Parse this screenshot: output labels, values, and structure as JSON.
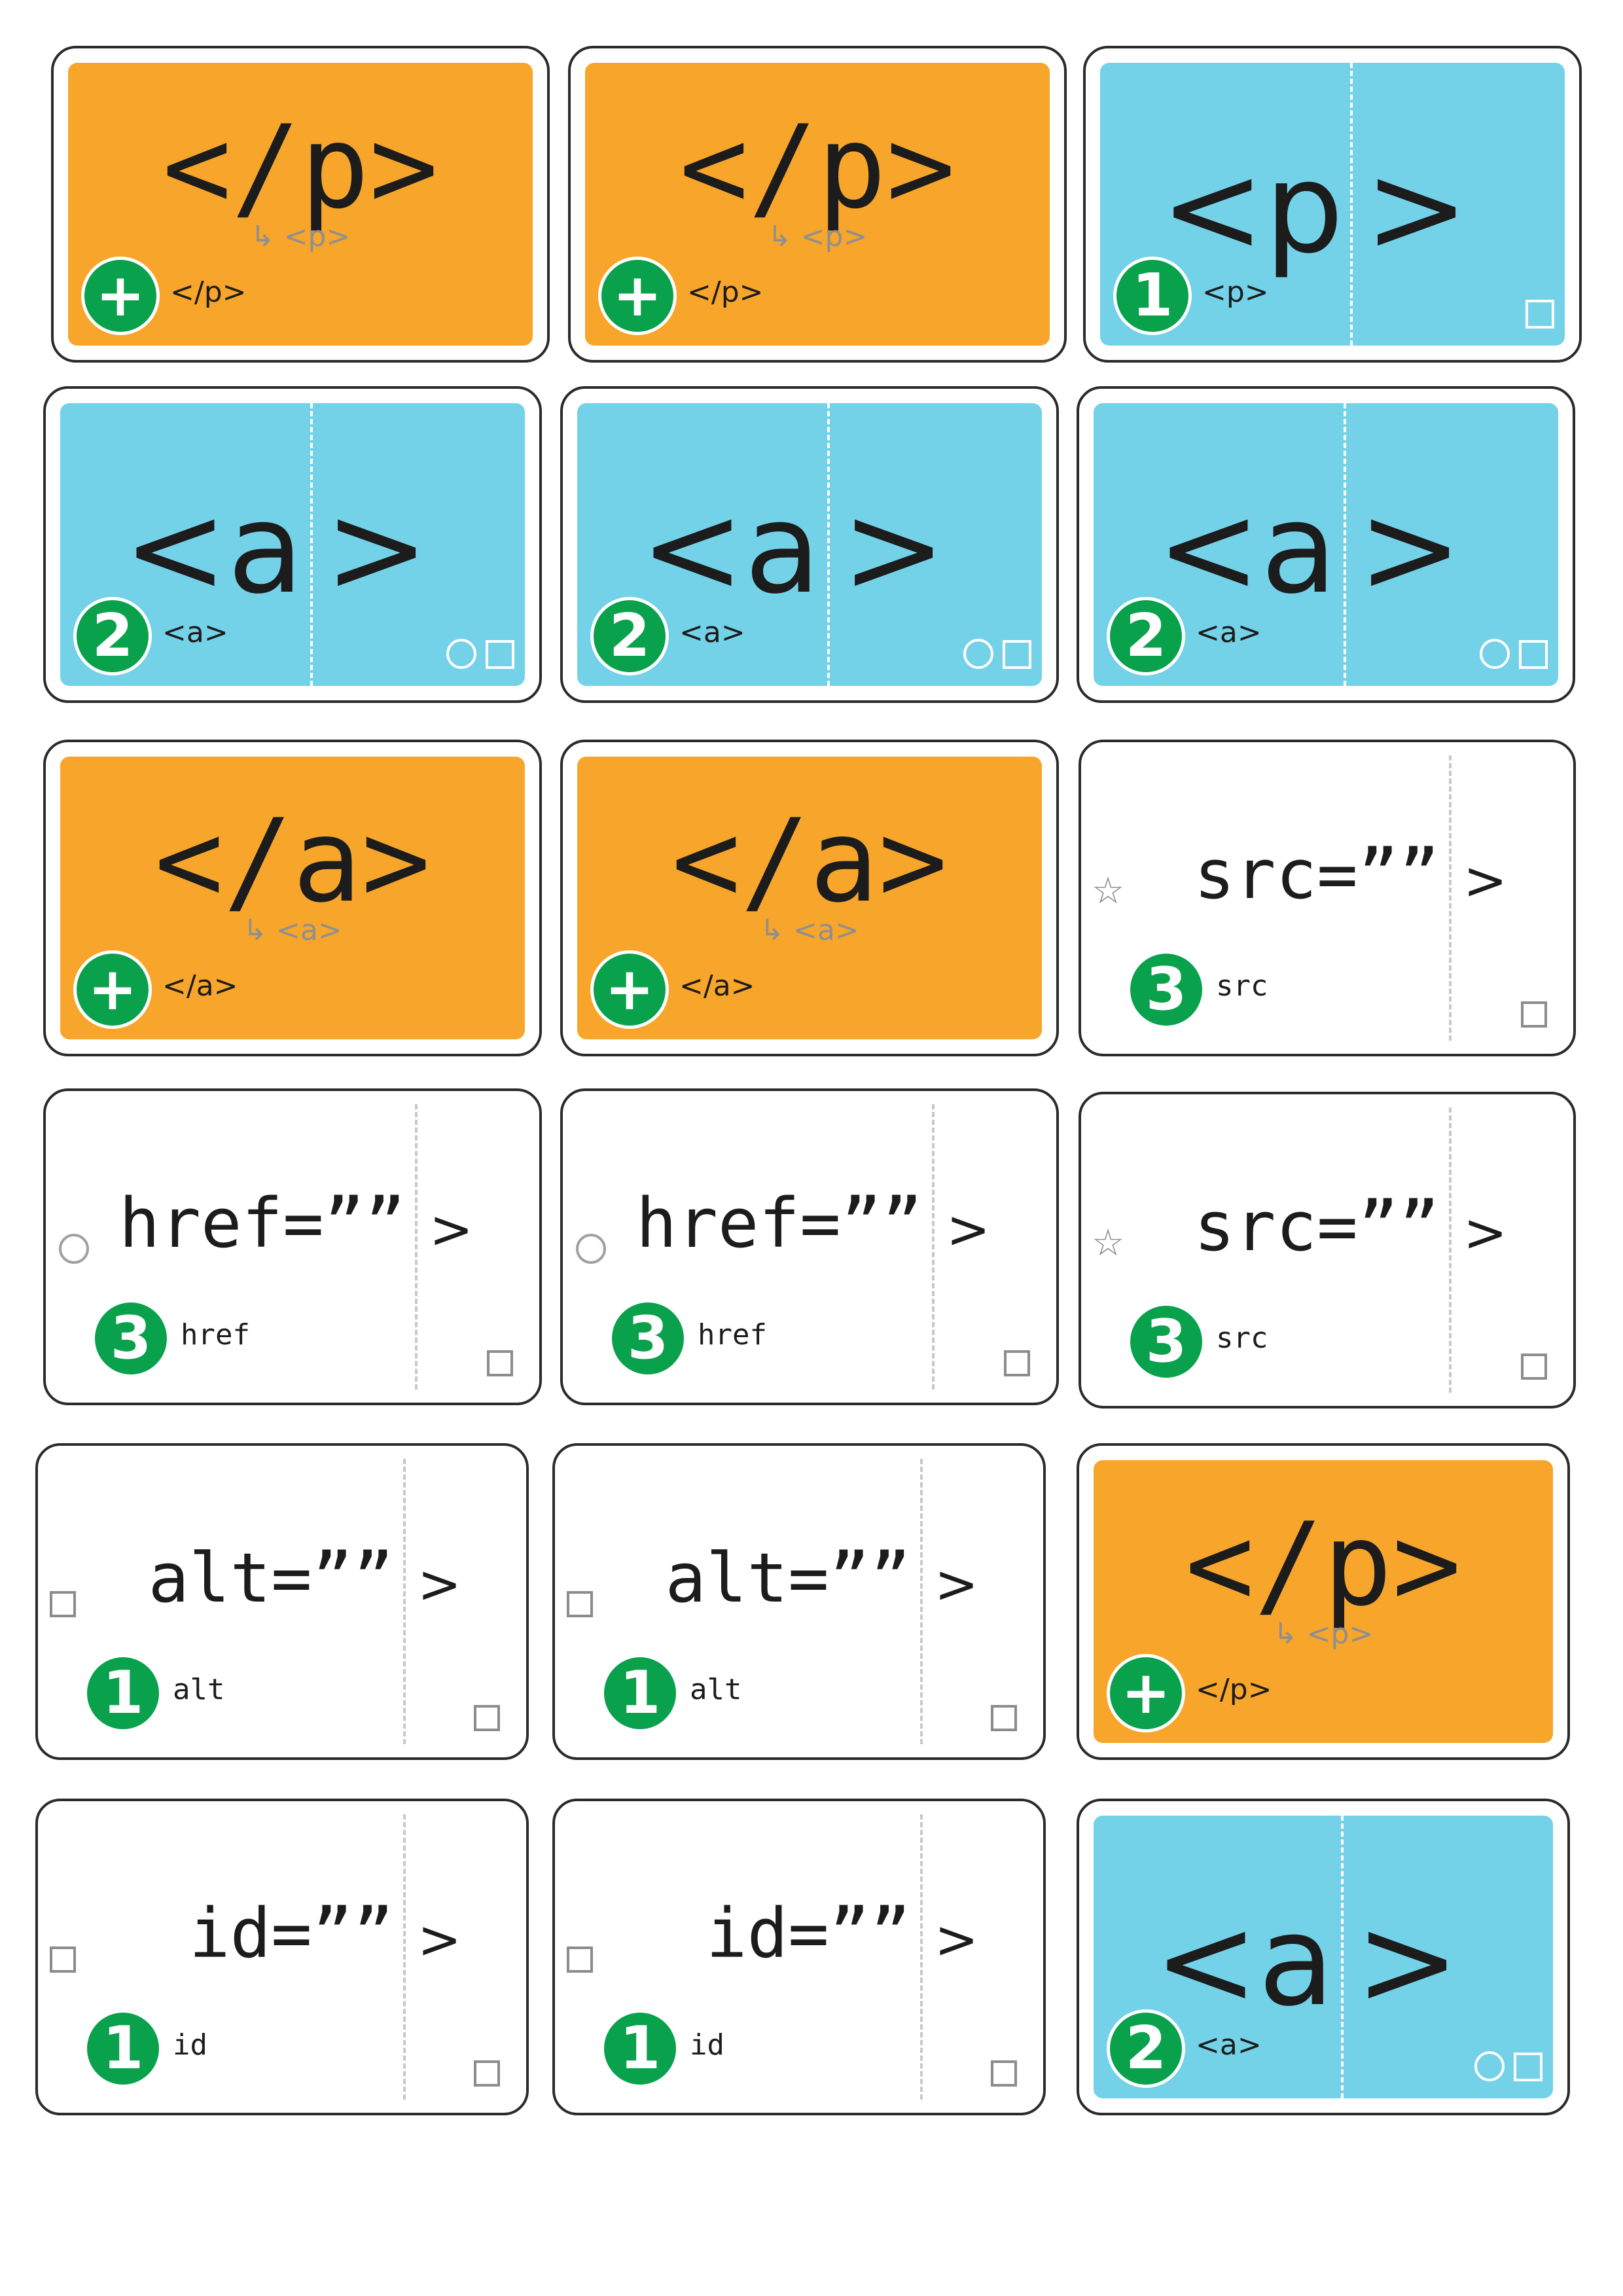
{
  "cards": [
    {
      "kind": "close",
      "tag": "</p>",
      "sub": "↳ <p>",
      "badge": "+",
      "label": "</p>"
    },
    {
      "kind": "close",
      "tag": "</p>",
      "sub": "↳ <p>",
      "badge": "+",
      "label": "</p>"
    },
    {
      "kind": "open",
      "tag": "<p",
      ">": ">",
      "badge": "1",
      "label": "<p>",
      "circle": false
    },
    {
      "kind": "open",
      "tag": "<a",
      "badge": "2",
      "label": "<a>",
      "circle": true
    },
    {
      "kind": "open",
      "tag": "<a",
      "badge": "2",
      "label": "<a>",
      "circle": true
    },
    {
      "kind": "open",
      "tag": "<a",
      "badge": "2",
      "label": "<a>",
      "circle": true
    },
    {
      "kind": "close",
      "tag": "</a>",
      "sub": "↳ <a>",
      "badge": "+",
      "label": "</a>"
    },
    {
      "kind": "close",
      "tag": "</a>",
      "sub": "↳ <a>",
      "badge": "+",
      "label": "</a>"
    },
    {
      "kind": "attr",
      "text": "src=””",
      "badge": "3",
      "label": "src",
      "mark": "star"
    },
    {
      "kind": "attr",
      "text": "href=””",
      "badge": "3",
      "label": "href",
      "mark": "circle"
    },
    {
      "kind": "attr",
      "text": "href=””",
      "badge": "3",
      "label": "href",
      "mark": "circle"
    },
    {
      "kind": "attr",
      "text": "src=””",
      "badge": "3",
      "label": "src",
      "mark": "star"
    },
    {
      "kind": "attr",
      "text": "alt=””",
      "badge": "1",
      "label": "alt",
      "mark": "square"
    },
    {
      "kind": "attr",
      "text": "alt=””",
      "badge": "1",
      "label": "alt",
      "mark": "square"
    },
    {
      "kind": "close",
      "tag": "</p>",
      "sub": "↳ <p>",
      "badge": "+",
      "label": "</p>"
    },
    {
      "kind": "attr",
      "text": "id=””",
      "badge": "1",
      "label": "id",
      "mark": "square"
    },
    {
      "kind": "attr",
      "text": "id=””",
      "badge": "1",
      "label": "id",
      "mark": "square"
    },
    {
      "kind": "open",
      "tag": "<a",
      "badge": "2",
      "label": "<a>",
      "circle": true
    }
  ],
  "gt": ">",
  "colors": {
    "orange": "#f7a52b",
    "blue": "#73d1e8",
    "green": "#0aa14d"
  }
}
